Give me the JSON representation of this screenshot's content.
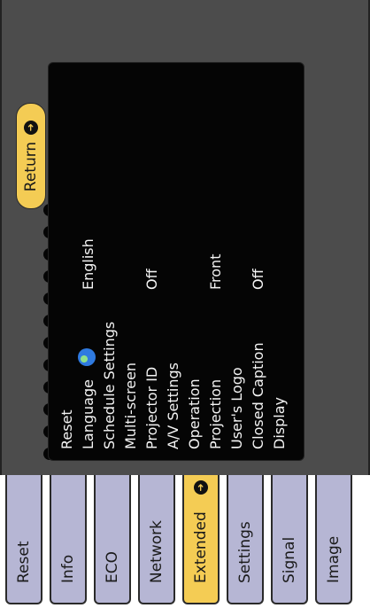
{
  "tabs": [
    {
      "label": "Reset"
    },
    {
      "label": "Info"
    },
    {
      "label": "ECO"
    },
    {
      "label": "Network"
    },
    {
      "label": "Extended",
      "active": true
    },
    {
      "label": "Settings"
    },
    {
      "label": "Signal"
    },
    {
      "label": "Image"
    }
  ],
  "menu": {
    "return_label": "Return",
    "items": [
      {
        "label": "Reset",
        "value": ""
      },
      {
        "label": "Language",
        "value": "English",
        "icon": "globe-icon"
      },
      {
        "label": "Schedule Settings",
        "value": ""
      },
      {
        "label": "Multi-screen",
        "value": ""
      },
      {
        "label": "Projector ID",
        "value": "Off"
      },
      {
        "label": "A/V Settings",
        "value": ""
      },
      {
        "label": "Operation",
        "value": ""
      },
      {
        "label": "Projection",
        "value": "Front"
      },
      {
        "label": "User's Logo",
        "value": ""
      },
      {
        "label": "Closed Caption",
        "value": "Off"
      },
      {
        "label": "Display",
        "value": ""
      }
    ]
  },
  "colors": {
    "active_tab": "#f4cc54",
    "inactive_tab": "#b6b6d4",
    "frame": "#4c4c4c",
    "panel": "#050505",
    "text_light": "#f4f4f4"
  },
  "icons": {
    "return": "return-arrow-icon",
    "active_tab": "return-arrow-icon"
  }
}
